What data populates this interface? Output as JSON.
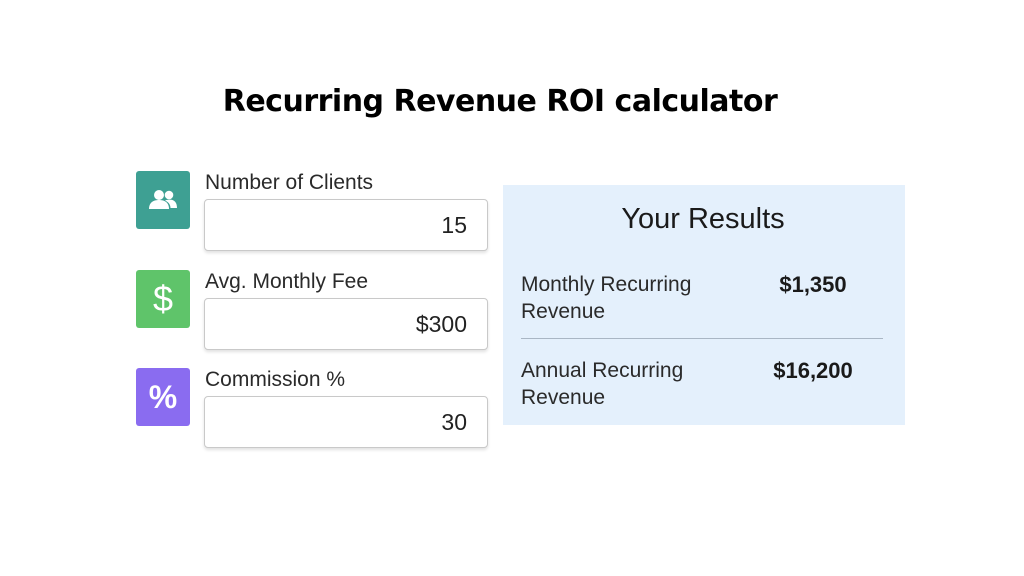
{
  "page": {
    "title": "Recurring Revenue ROI calculator"
  },
  "inputs": [
    {
      "label": "Number of Clients",
      "value": "15",
      "icon": "people-icon",
      "color": "#3ea093"
    },
    {
      "label": "Avg. Monthly Fee",
      "value": "$300",
      "icon": "dollar-icon",
      "color": "#5fc46a",
      "icon_glyph": "$"
    },
    {
      "label": "Commission %",
      "value": "30",
      "icon": "percent-icon",
      "color": "#8a6cf0",
      "icon_glyph": "%"
    }
  ],
  "results": {
    "title": "Your Results",
    "background": "#e4f0fc",
    "rows": [
      {
        "label": "Monthly Recurring Revenue",
        "value": "$1,350"
      },
      {
        "label": "Annual Recurring Revenue",
        "value": "$16,200"
      }
    ]
  }
}
